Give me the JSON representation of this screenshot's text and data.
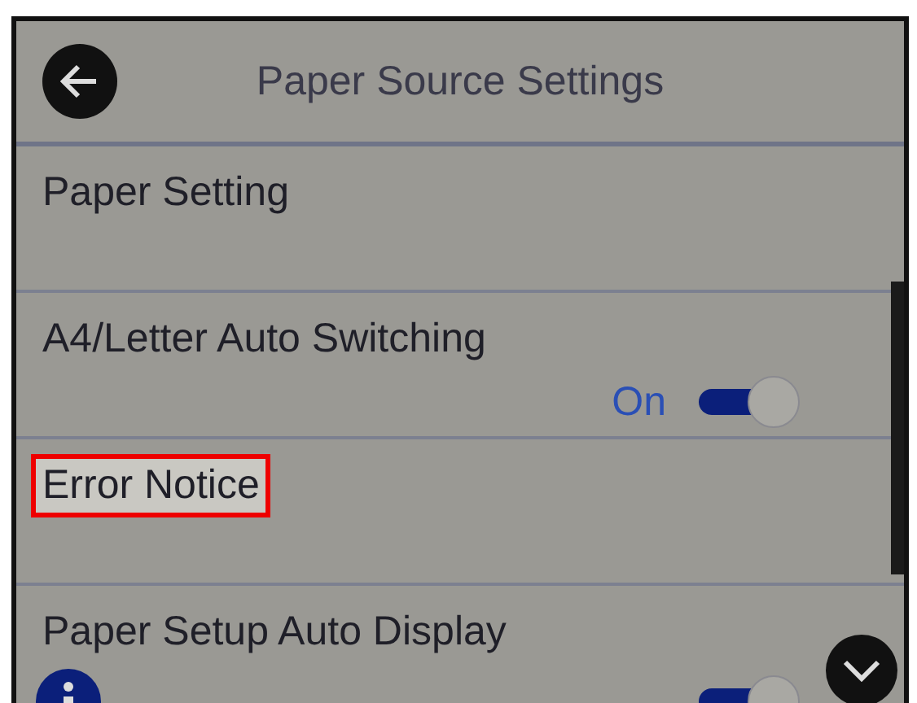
{
  "header": {
    "title": "Paper Source Settings"
  },
  "items": [
    {
      "label": "Paper Setting",
      "highlighted": false
    },
    {
      "label": "A4/Letter Auto Switching",
      "value": "On",
      "on": true,
      "highlighted": false
    },
    {
      "label": "Error Notice",
      "highlighted": true
    },
    {
      "label": "Paper Setup Auto Display",
      "on": true,
      "info": true,
      "highlighted": false
    }
  ]
}
